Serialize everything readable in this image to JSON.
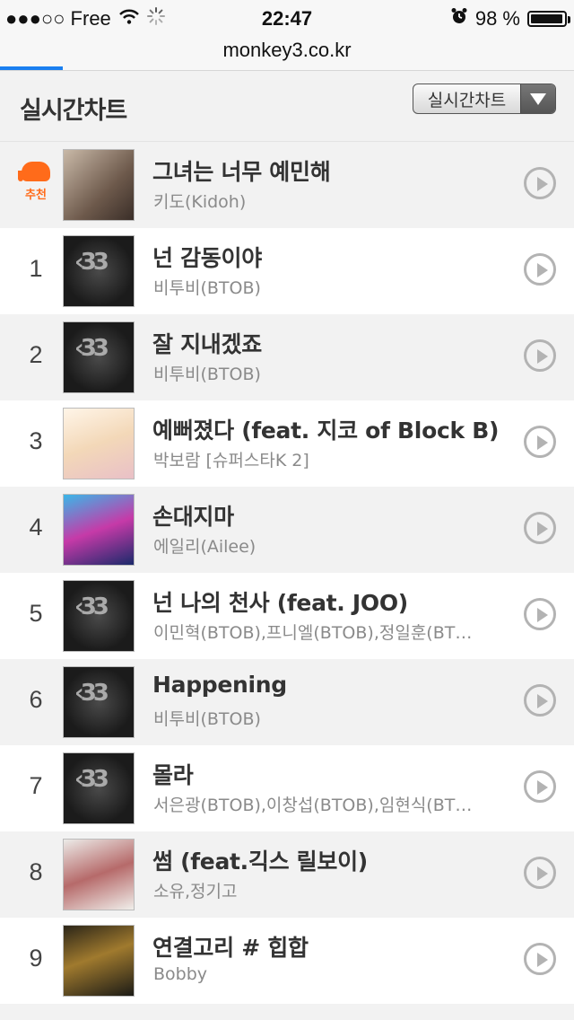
{
  "status_bar": {
    "carrier": "●●●○○ Free",
    "time": "22:47",
    "battery": "98 %",
    "battery_level": 0.98
  },
  "browser": {
    "url": "monkey3.co.kr",
    "load_progress": 0.11
  },
  "header": {
    "title": "실시간차트",
    "dropdown_selected": "실시간차트"
  },
  "recommend_label": "추천",
  "songs": [
    {
      "rank": "",
      "recommended": true,
      "title": "그녀는 너무 예민해",
      "artist": "키도(Kidoh)",
      "cover": "kidoh"
    },
    {
      "rank": "1",
      "title": "넌 감동이야",
      "artist": "비투비(BTOB)",
      "cover": "btob"
    },
    {
      "rank": "2",
      "title": "잘 지내겠죠",
      "artist": "비투비(BTOB)",
      "cover": "btob"
    },
    {
      "rank": "3",
      "title": "예뻐졌다 (feat. 지코 of Block B)",
      "artist": "박보람 [슈퍼스타K 2]",
      "cover": "boram"
    },
    {
      "rank": "4",
      "title": "손대지마",
      "artist": "에일리(Ailee)",
      "cover": "ailee"
    },
    {
      "rank": "5",
      "title": "넌 나의 천사 (feat. JOO)",
      "artist": "이민혁(BTOB),프니엘(BTOB),정일훈(BT…",
      "cover": "btob"
    },
    {
      "rank": "6",
      "title": "Happening",
      "artist": "비투비(BTOB)",
      "cover": "btob"
    },
    {
      "rank": "7",
      "title": "몰라",
      "artist": "서은광(BTOB),이창섭(BTOB),임현식(BT…",
      "cover": "btob"
    },
    {
      "rank": "8",
      "title": "썸 (feat.긱스 릴보이)",
      "artist": "소유,정기고",
      "cover": "soyou"
    },
    {
      "rank": "9",
      "title": "연결고리 # 힙합",
      "artist": "Bobby",
      "cover": "bobby"
    }
  ]
}
